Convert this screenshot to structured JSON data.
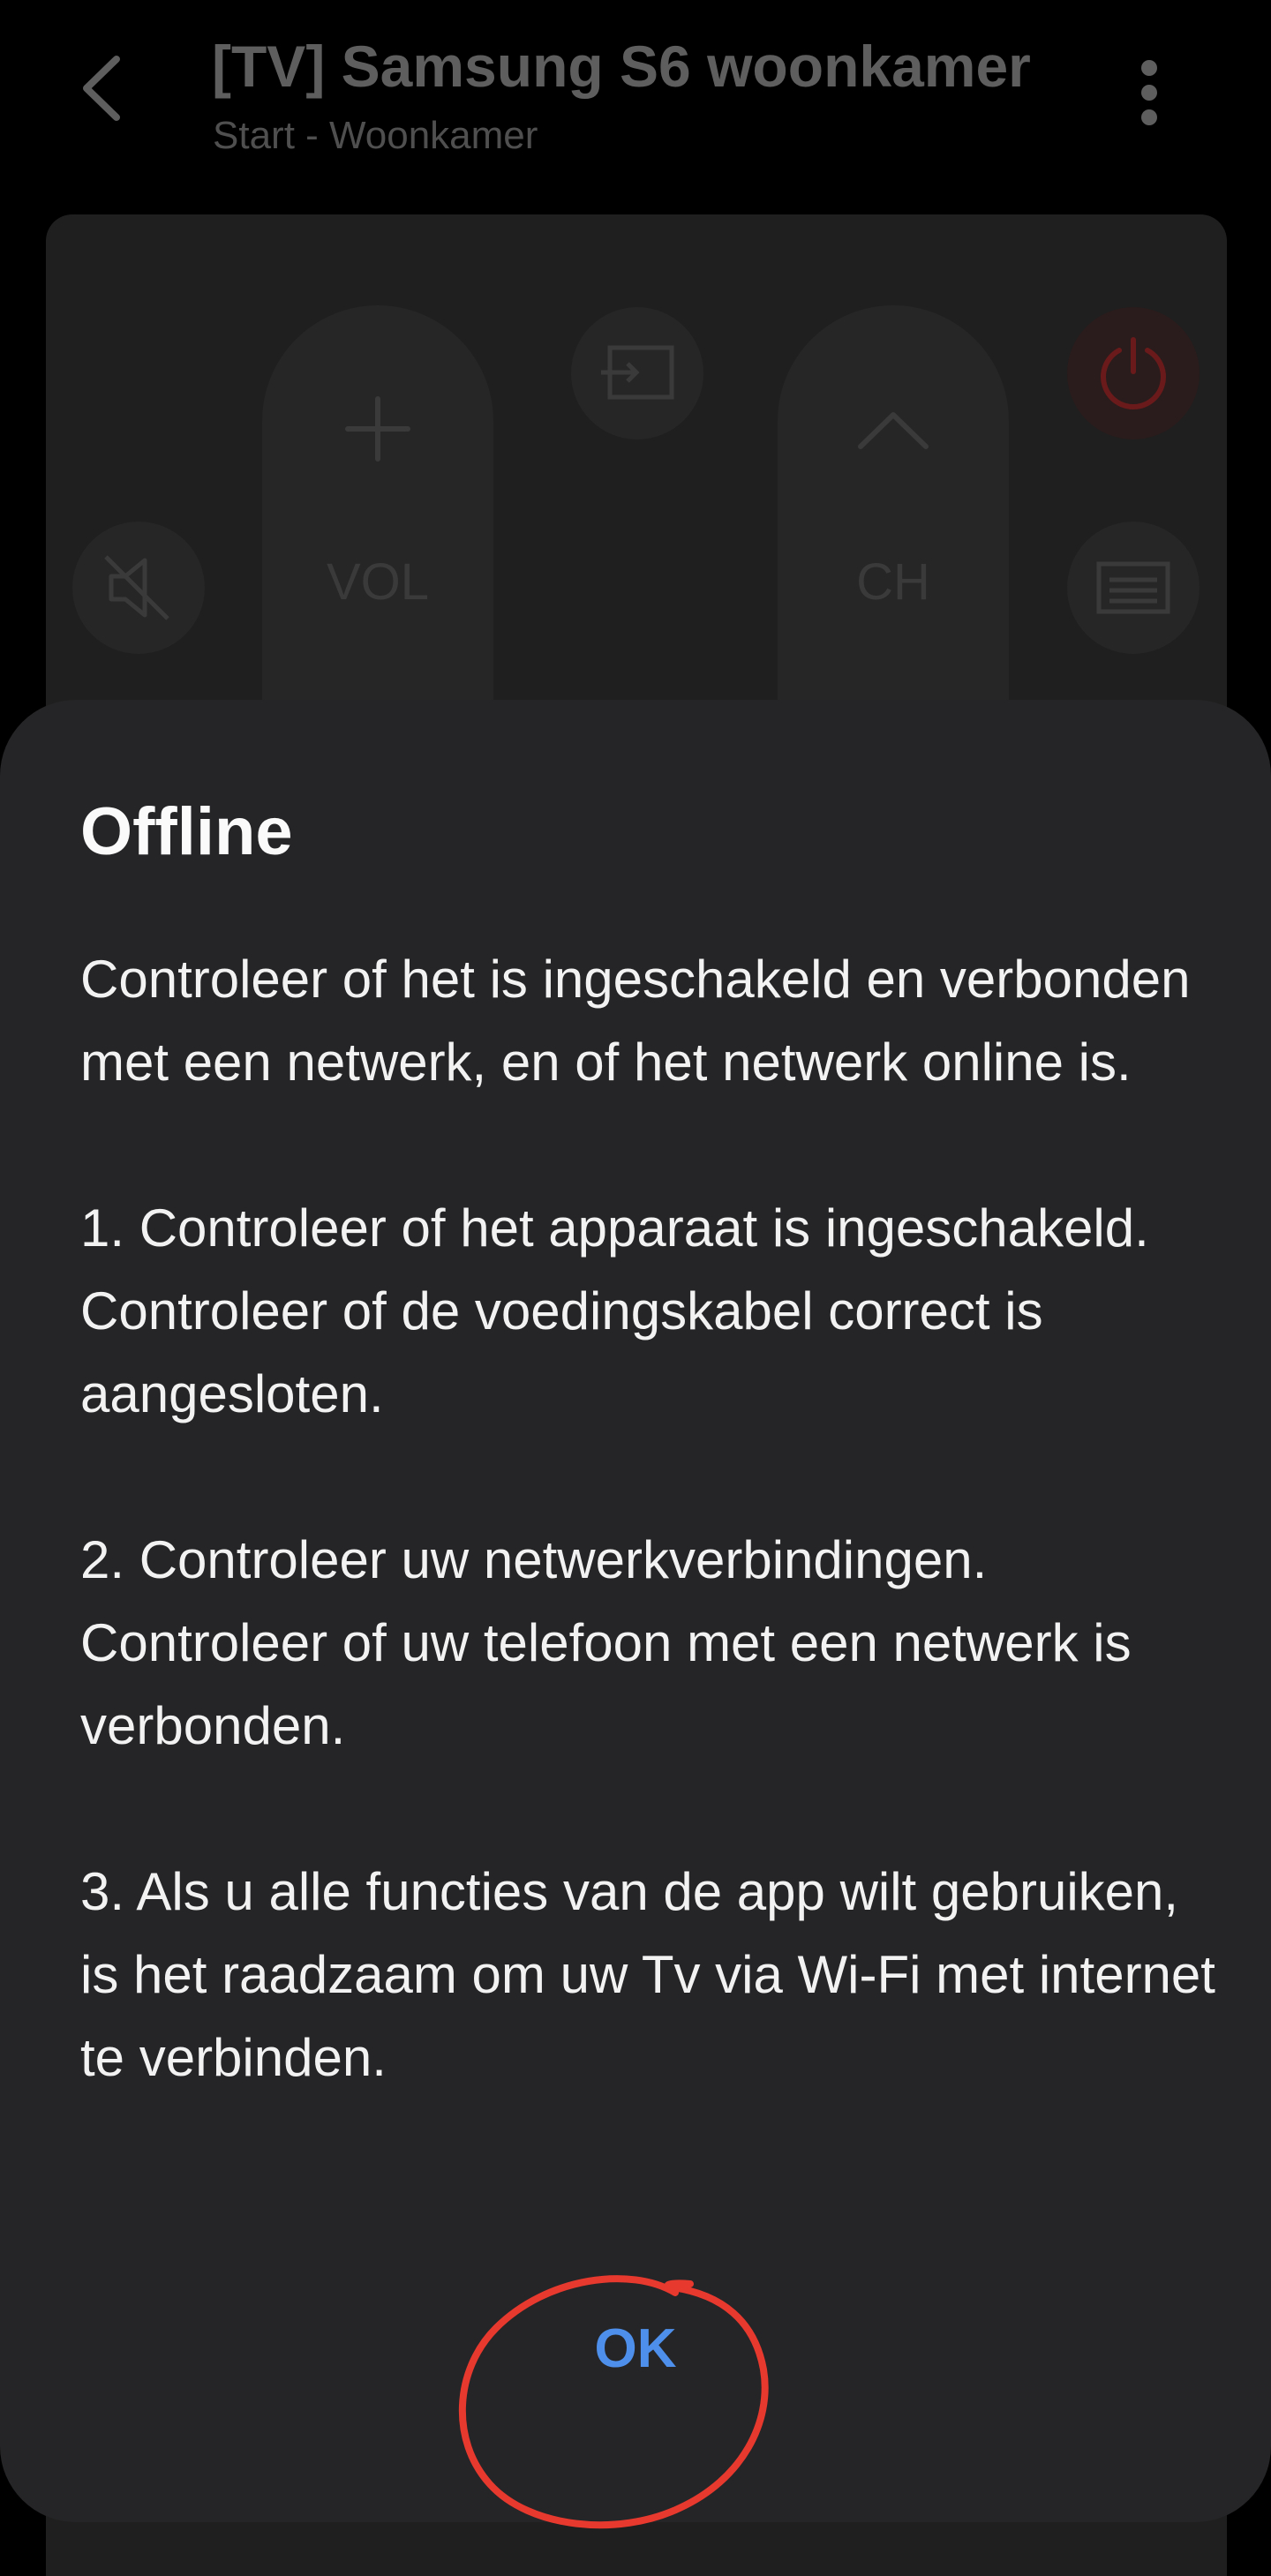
{
  "header": {
    "title": "[TV] Samsung S6 woonkamer",
    "subtitle": "Start - Woonkamer",
    "back_icon": "chevron-left-icon",
    "more_icon": "more-vertical-icon"
  },
  "remote": {
    "vol_label": "VOL",
    "ch_label": "CH",
    "icons": {
      "mute": "mute-icon",
      "vol_up": "plus-icon",
      "source": "source-icon",
      "ch_up": "chevron-up-icon",
      "power": "power-icon",
      "guide": "guide-icon"
    }
  },
  "dialog": {
    "title": "Offline",
    "paragraphs": [
      "Controleer of het is ingeschakeld en verbonden met een netwerk, en of het netwerk online is.",
      "1. Controleer of het apparaat is ingeschakeld.\nControleer of de voedingskabel correct is aangesloten.",
      "2. Controleer uw netwerkverbindingen.\nControleer of uw telefoon met een netwerk is verbonden.",
      "3. Als u alle functies van de app wilt gebruiken, is het raadzaam om uw Tv via Wi-Fi met internet te verbinden."
    ],
    "ok_label": "OK"
  },
  "colors": {
    "background": "#000000",
    "dialog": "#252527",
    "accent": "#4d8fea",
    "power": "#6a1a1a",
    "annotation": "#e8392e"
  }
}
